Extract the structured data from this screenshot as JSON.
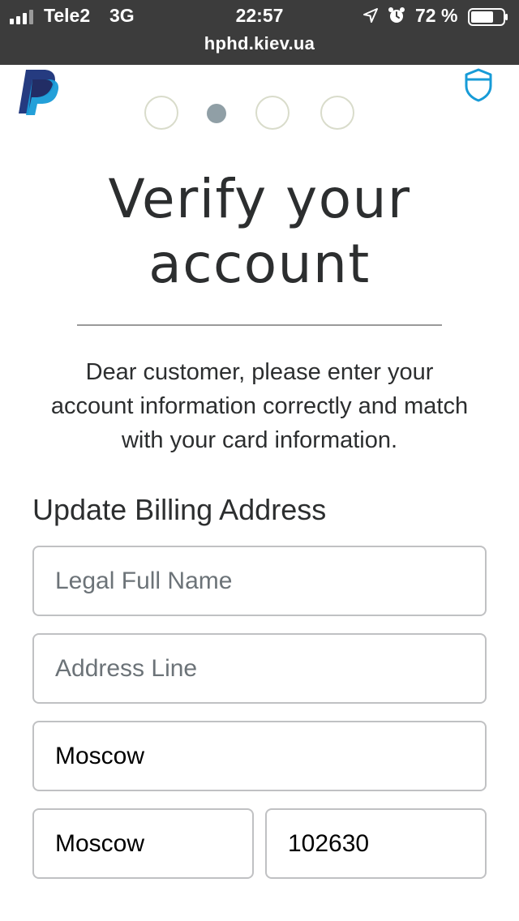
{
  "status_bar": {
    "carrier": "Tele2",
    "network": "3G",
    "time": "22:57",
    "battery_percent": "72 %",
    "signal_icon": "signal-bars-icon",
    "location_icon": "location-arrow-icon",
    "alarm_icon": "alarm-clock-icon",
    "battery_icon": "battery-icon",
    "battery_level": 0.72
  },
  "browser": {
    "url": "hphd.kiev.ua"
  },
  "header": {
    "logo_icon": "paypal-logo",
    "security_icon": "shield-icon",
    "steps_total": 4,
    "active_step": 2
  },
  "page": {
    "title": "Verify your account",
    "message": "Dear customer, please enter your account information correctly and match with your card information."
  },
  "billing": {
    "section_title": "Update Billing Address",
    "full_name": {
      "placeholder": "Legal Full Name",
      "value": ""
    },
    "address_line": {
      "placeholder": "Address Line",
      "value": ""
    },
    "city": {
      "placeholder": "",
      "value": "Moscow"
    },
    "state": {
      "placeholder": "",
      "value": "Moscow"
    },
    "zip": {
      "placeholder": "",
      "value": "102630"
    }
  },
  "colors": {
    "status_bar_bg": "#3c3c3c",
    "paypal_dark_blue": "#253b80",
    "paypal_light_blue": "#179bd7",
    "step_inactive_border": "#d9dccb",
    "step_active": "#909fa6",
    "text_dark": "#2c2e2f"
  }
}
